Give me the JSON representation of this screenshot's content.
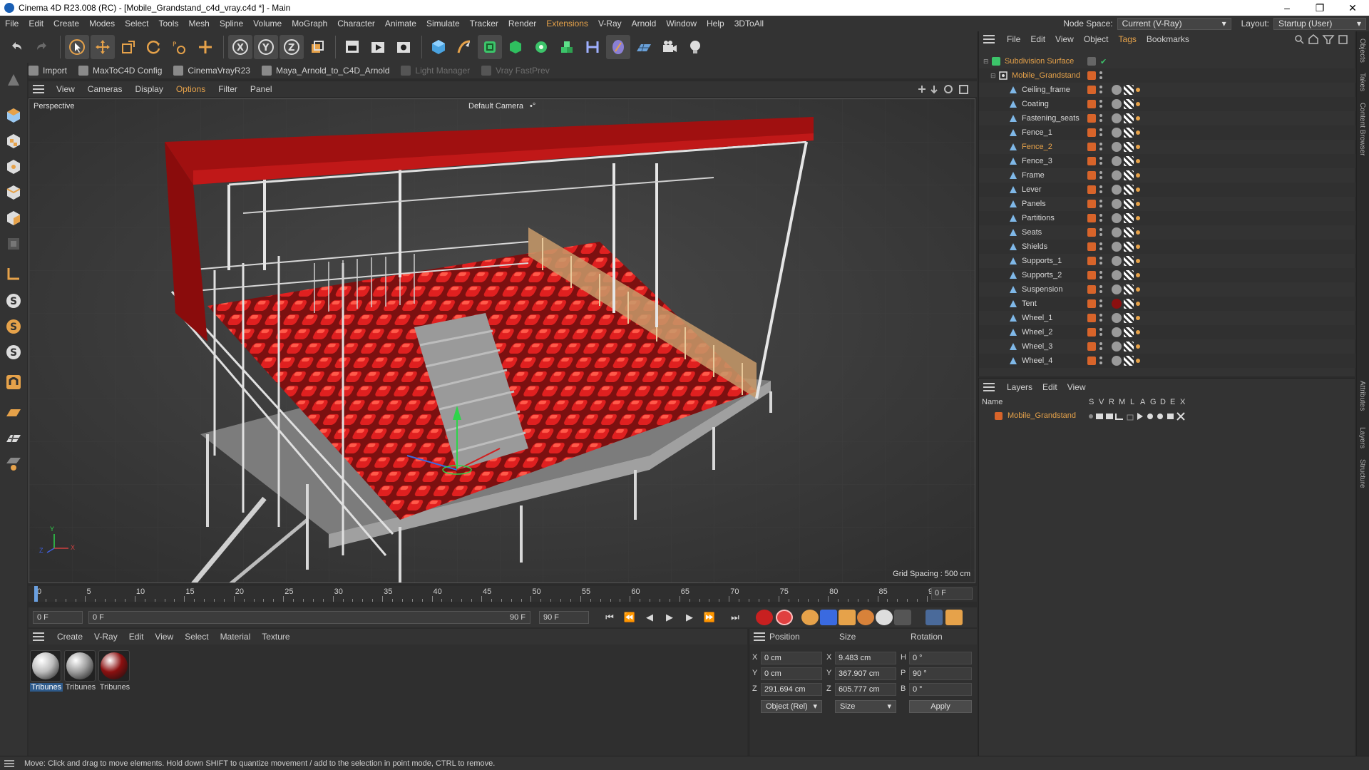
{
  "window": {
    "title": "Cinema 4D R23.008 (RC) - [Mobile_Grandstand_c4d_vray.c4d *] - Main",
    "min": "–",
    "max": "❐",
    "close": "✕"
  },
  "menubar": {
    "items": [
      "File",
      "Edit",
      "Create",
      "Modes",
      "Select",
      "Tools",
      "Mesh",
      "Spline",
      "Volume",
      "MoGraph",
      "Character",
      "Animate",
      "Simulate",
      "Tracker",
      "Render",
      "Extensions",
      "V-Ray",
      "Arnold",
      "Window",
      "Help",
      "3DToAll"
    ],
    "node_space_label": "Node Space:",
    "node_space_value": "Current (V-Ray)",
    "layout_label": "Layout:",
    "layout_value": "Startup (User)"
  },
  "plugins": {
    "items": [
      {
        "label": "Import",
        "enabled": true
      },
      {
        "label": "MaxToC4D Config",
        "enabled": true
      },
      {
        "label": "CinemaVrayR23",
        "enabled": true
      },
      {
        "label": "Maya_Arnold_to_C4D_Arnold",
        "enabled": true
      },
      {
        "label": "Light Manager",
        "enabled": false
      },
      {
        "label": "Vray FastPrev",
        "enabled": false
      }
    ]
  },
  "viewport": {
    "menu": [
      "View",
      "Cameras",
      "Display",
      "Options",
      "Filter",
      "Panel"
    ],
    "view_name": "Perspective",
    "camera": "Default Camera",
    "camera_mark": "•°",
    "grid_spacing": "Grid Spacing : 500 cm",
    "axis_x": "X",
    "axis_y": "Y",
    "axis_z": "Z"
  },
  "timeline": {
    "ticks": [
      "0",
      "5",
      "10",
      "15",
      "20",
      "25",
      "30",
      "35",
      "40",
      "45",
      "50",
      "55",
      "60",
      "65",
      "70",
      "75",
      "80",
      "85",
      "90"
    ],
    "current_frame": "0 F"
  },
  "transport": {
    "start": "0 F",
    "range_start": "0 F",
    "range_end": "90 F",
    "end": "90 F"
  },
  "materials": {
    "menu": [
      "Create",
      "V-Ray",
      "Edit",
      "View",
      "Select",
      "Material",
      "Texture"
    ],
    "items": [
      {
        "name": "Tribunes",
        "color": "#bdbdbd"
      },
      {
        "name": "Tribunes",
        "color": "#9e9e9e"
      },
      {
        "name": "Tribunes",
        "color": "#8b1010"
      }
    ]
  },
  "coordinates": {
    "position_label": "Position",
    "size_label": "Size",
    "rotation_label": "Rotation",
    "rows": [
      {
        "axis": "X",
        "pos": "0 cm",
        "size_axis": "X",
        "size": "9.483 cm",
        "rot_axis": "H",
        "rot": "0 °"
      },
      {
        "axis": "Y",
        "pos": "0 cm",
        "size_axis": "Y",
        "size": "367.907 cm",
        "rot_axis": "P",
        "rot": "90 °"
      },
      {
        "axis": "Z",
        "pos": "291.694 cm",
        "size_axis": "Z",
        "size": "605.777 cm",
        "rot_axis": "B",
        "rot": "0 °"
      }
    ],
    "mode": "Object (Rel)",
    "size_mode": "Size",
    "apply": "Apply"
  },
  "objects": {
    "menu": [
      "File",
      "Edit",
      "View",
      "Object",
      "Tags",
      "Bookmarks"
    ],
    "root": "Subdivision Surface",
    "group": "Mobile_Grandstand",
    "children": [
      "Ceiling_frame",
      "Coating",
      "Fastening_seats",
      "Fence_1",
      "Fence_2",
      "Fence_3",
      "Frame",
      "Lever",
      "Panels",
      "Partitions",
      "Seats",
      "Shields",
      "Supports_1",
      "Supports_2",
      "Suspension",
      "Tent",
      "Wheel_1",
      "Wheel_2",
      "Wheel_3",
      "Wheel_4"
    ],
    "selected": "Fence_2"
  },
  "layers": {
    "menu": [
      "Layers",
      "Edit",
      "View"
    ],
    "headers": [
      "Name",
      "S",
      "V",
      "R",
      "M",
      "L",
      "A",
      "G",
      "D",
      "E",
      "X"
    ],
    "rows": [
      {
        "name": "Mobile_Grandstand",
        "color": "#d8642a"
      }
    ]
  },
  "sidetabs": [
    "Objects",
    "Takes",
    "Content Browser",
    "Attributes",
    "Layers",
    "Structure"
  ],
  "status": "Move: Click and drag to move elements. Hold down SHIFT to quantize movement / add to the selection in point mode, CTRL to remove.",
  "colors": {
    "accent": "#e6a24a",
    "layer_orange": "#d8642a",
    "seat_red": "#d21a1a"
  }
}
